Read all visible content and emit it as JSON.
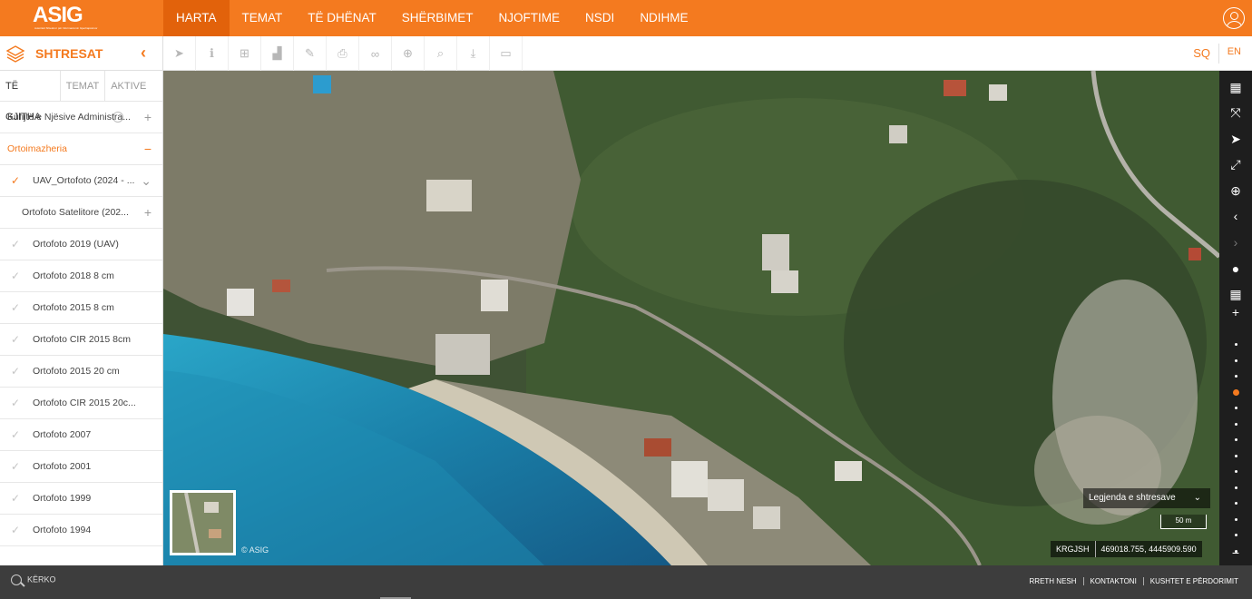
{
  "header": {
    "logo_text": "ASIG",
    "logo_subtext": "Autoriteti Shtetëror për Informacionin Gjeohapësinor",
    "nav": [
      "HARTA",
      "TEMAT",
      "TË DHËNAT",
      "SHËRBIMET",
      "NJOFTIME",
      "NSDI",
      "NDIHME"
    ],
    "active_nav": "HARTA"
  },
  "toolbar": {
    "panel_title": "SHTRESAT",
    "lang_sq": "SQ",
    "lang_en": "EN",
    "tools": [
      "select-icon",
      "info-icon",
      "plus-square-icon",
      "chart-icon",
      "edit-icon",
      "print-icon",
      "link-icon",
      "add-circle-icon",
      "search-icon",
      "download-icon",
      "image-icon"
    ]
  },
  "sidebar": {
    "tabs": [
      "TË GJITHA",
      "TEMAT",
      "AKTIVE"
    ],
    "rows": [
      {
        "label": "Kufijtë e Njësive Administra...",
        "sign": "+",
        "style": "category"
      },
      {
        "label": "Ortoimazheria",
        "sign": "−",
        "style": "category-open"
      },
      {
        "label": "UAV_Ortofoto (2024 - ...",
        "sign": "⌄",
        "style": "checked"
      },
      {
        "label": "Ortofoto Satelitore (202...",
        "sign": "+",
        "style": "sub"
      },
      {
        "label": "Ortofoto 2019 (UAV)",
        "sign": "",
        "style": "unchecked"
      },
      {
        "label": "Ortofoto 2018 8 cm",
        "sign": "",
        "style": "unchecked"
      },
      {
        "label": "Ortofoto 2015 8 cm",
        "sign": "",
        "style": "unchecked"
      },
      {
        "label": "Ortofoto CIR 2015 8cm",
        "sign": "",
        "style": "unchecked"
      },
      {
        "label": "Ortofoto 2015 20 cm",
        "sign": "",
        "style": "unchecked"
      },
      {
        "label": "Ortofoto CIR 2015 20c...",
        "sign": "",
        "style": "unchecked"
      },
      {
        "label": "Ortofoto 2007",
        "sign": "",
        "style": "unchecked"
      },
      {
        "label": "Ortofoto 2001",
        "sign": "",
        "style": "unchecked"
      },
      {
        "label": "Ortofoto 1999",
        "sign": "",
        "style": "unchecked"
      },
      {
        "label": "Ortofoto 1994",
        "sign": "",
        "style": "unchecked"
      }
    ]
  },
  "map": {
    "copyright": "© ASIG",
    "legend_label": "Legjenda e shtresave",
    "scale_label": "50 m",
    "projection": "KRGJSH",
    "coordinates": "469018.755, 4445909.590",
    "zoom_levels": 16,
    "active_zoom_level": 3
  },
  "footer": {
    "search_label": "KËRKO",
    "links": [
      "RRETH NESH",
      "KONTAKTONI",
      "KUSHTET E PËRDORIMIT"
    ]
  },
  "colors": {
    "accent": "#f47a1f",
    "accent_dark": "#e2620b",
    "footer_bg": "#3d3d3d",
    "controls_bg": "#1e1e1e"
  }
}
